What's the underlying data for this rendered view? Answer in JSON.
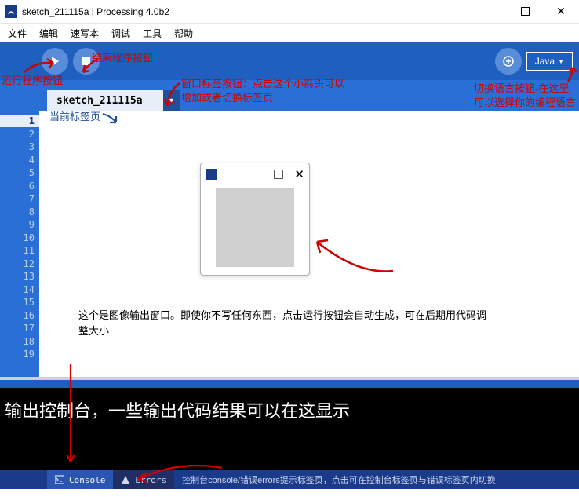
{
  "titlebar": {
    "title": "sketch_211115a | Processing 4.0b2"
  },
  "menubar": {
    "items": [
      "文件",
      "编辑",
      "速写本",
      "调试",
      "工具",
      "帮助"
    ]
  },
  "language_button": {
    "label": "Java",
    "caret": "▼"
  },
  "tab": {
    "name": "sketch_211115a"
  },
  "gutter": {
    "lines": [
      "1",
      "2",
      "3",
      "4",
      "5",
      "6",
      "7",
      "8",
      "9",
      "10",
      "11",
      "12",
      "13",
      "14",
      "15",
      "16",
      "17",
      "18",
      "19"
    ]
  },
  "console": {
    "text": "输出控制台，一些输出代码结果可以在这显示"
  },
  "bottom_tabs": {
    "console": "Console",
    "errors": "Errors",
    "hint": "控制台console/错误errors提示标签页，点击可在控制台标签页与错误标签页内切换"
  },
  "annotations": {
    "run": "运行程序按钮",
    "stop": "结束程序按钮",
    "tab_arrow": "窗口标签按钮：点击这个小箭头可以增加或者切换标签页",
    "current_tab": "当前标签页",
    "lang": "切换语言按钮-在这里可以选择你的编程语言",
    "output_desc": "这个是图像输出窗口。即使你不写任何东西，点击运行按钮会自动生成，可在后期用代码调整大小"
  }
}
